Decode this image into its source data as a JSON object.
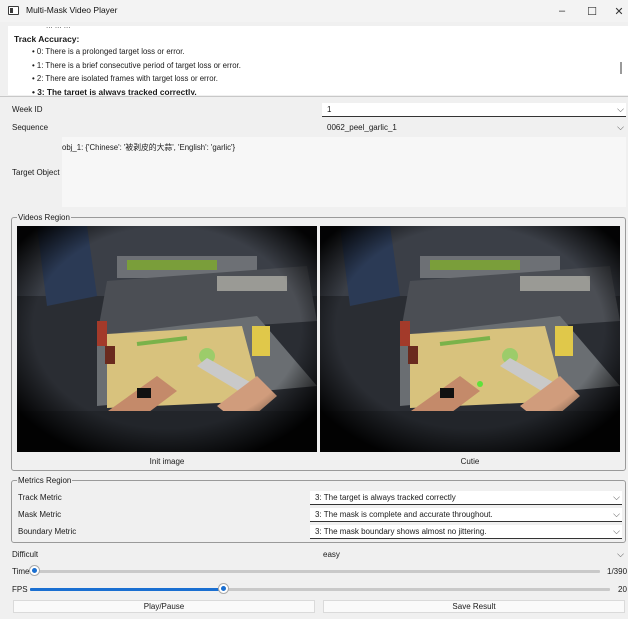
{
  "window": {
    "title": "Multi-Mask Video Player",
    "minimize": "–",
    "maximize": "☐",
    "close": "✕"
  },
  "instructions": {
    "cut_line": "... ... ...",
    "heading": "Track Accuracy:",
    "items": [
      "0: There is a prolonged target loss or error.",
      "1: There is a brief consecutive period of target loss or error.",
      "2: There are isolated frames with target loss or error.",
      "3: The target is always tracked correctly."
    ]
  },
  "form": {
    "week_id": {
      "label": "Week ID",
      "value": "1"
    },
    "sequence": {
      "label": "Sequence",
      "value": "0062_peel_garlic_1"
    },
    "target_object": {
      "label": "Target Object",
      "value": "obj_1: {'Chinese': '被剥皮的大蒜', 'English': 'garlic'}"
    }
  },
  "videos": {
    "group_title": "Videos Region",
    "left_label": "Init image",
    "right_label": "Cutie"
  },
  "metrics": {
    "group_title": "Metrics Region",
    "track": {
      "label": "Track Metric",
      "value": "3:  The target is always tracked correctly"
    },
    "mask": {
      "label": "Mask Metric",
      "value": "3: The mask is complete and accurate throughout."
    },
    "boundary": {
      "label": "Boundary Metric",
      "value": "3: The mask boundary shows almost no jittering."
    }
  },
  "difficult": {
    "label": "Difficult",
    "value": "easy"
  },
  "time": {
    "label": "Time",
    "current": 1,
    "total": 390,
    "display": "1/390"
  },
  "fps": {
    "label": "FPS",
    "value": 20,
    "max": 60,
    "display": "20"
  },
  "buttons": {
    "play_pause": "Play/Pause",
    "save_result": "Save Result"
  },
  "icons": {
    "arrow": "chevron-down-icon",
    "bullet": "•"
  },
  "colors": {
    "accent": "#1a6fd1",
    "mask_green": "#5fe23a"
  }
}
